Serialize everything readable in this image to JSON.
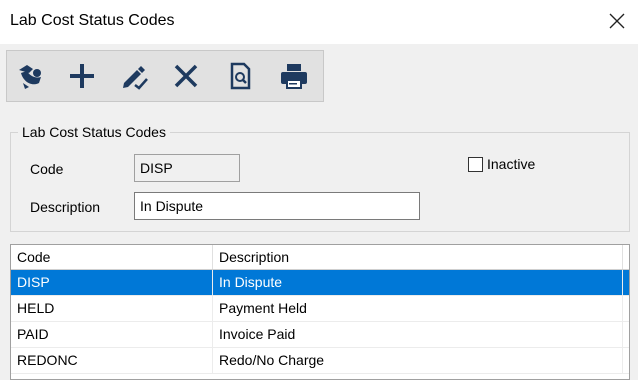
{
  "window": {
    "title": "Lab Cost Status Codes"
  },
  "toolbar": {
    "buttons": [
      {
        "name": "open-icon"
      },
      {
        "name": "add-icon"
      },
      {
        "name": "edit-icon"
      },
      {
        "name": "delete-icon"
      },
      {
        "name": "preview-icon"
      },
      {
        "name": "print-icon"
      }
    ],
    "icon_color": "#1e3a5f"
  },
  "group": {
    "legend": "Lab Cost Status Codes",
    "code_label": "Code",
    "code_value": "DISP",
    "description_label": "Description",
    "description_value": "In Dispute",
    "inactive_label": "Inactive",
    "inactive_checked": false
  },
  "grid": {
    "columns": [
      "Code",
      "Description"
    ],
    "rows": [
      {
        "code": "DISP",
        "description": "In Dispute",
        "selected": true
      },
      {
        "code": "HELD",
        "description": "Payment Held",
        "selected": false
      },
      {
        "code": "PAID",
        "description": "Invoice Paid",
        "selected": false
      },
      {
        "code": "REDONC",
        "description": "Redo/No Charge",
        "selected": false
      }
    ],
    "selection_color": "#0078d7"
  }
}
